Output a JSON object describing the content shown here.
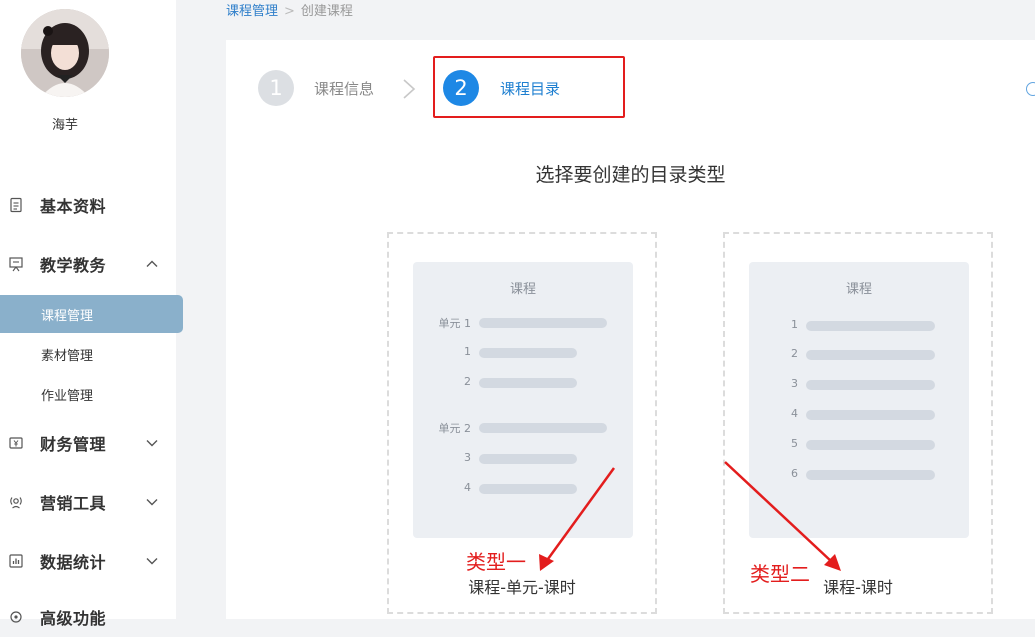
{
  "user": {
    "name": "海芋"
  },
  "sidebar": {
    "groups": [
      {
        "label": "基本资料",
        "icon": "document-icon"
      },
      {
        "label": "教学教务",
        "icon": "teaching-board-icon",
        "expanded": true,
        "items": [
          {
            "label": "课程管理",
            "active": true
          },
          {
            "label": "素材管理"
          },
          {
            "label": "作业管理"
          }
        ]
      },
      {
        "label": "财务管理",
        "icon": "finance-icon"
      },
      {
        "label": "营销工具",
        "icon": "broadcast-icon"
      },
      {
        "label": "数据统计",
        "icon": "chart-icon"
      },
      {
        "label": "高级功能",
        "icon": "advanced-icon"
      }
    ]
  },
  "breadcrumb": {
    "parent": "课程管理",
    "current": "创建课程",
    "separator": ">"
  },
  "steps": [
    {
      "number": "1",
      "label": "课程信息",
      "state": "done"
    },
    {
      "number": "2",
      "label": "课程目录",
      "state": "active"
    }
  ],
  "main": {
    "title": "选择要创建的目录类型"
  },
  "cards": [
    {
      "preview_title": "课程",
      "rows": [
        {
          "label": "单元 1",
          "bar": "long",
          "gap_before": false
        },
        {
          "label": "1",
          "bar": "short",
          "gap_before": false
        },
        {
          "label": "2",
          "bar": "short",
          "gap_before": false
        },
        {
          "label": "单元 2",
          "bar": "long",
          "gap_before": true
        },
        {
          "label": "3",
          "bar": "short",
          "gap_before": false
        },
        {
          "label": "4",
          "bar": "short",
          "gap_before": false
        }
      ],
      "caption": "课程-单元-课时",
      "annotation": "类型一"
    },
    {
      "preview_title": "课程",
      "rows": [
        {
          "label": "1",
          "bar": "long"
        },
        {
          "label": "2",
          "bar": "long"
        },
        {
          "label": "3",
          "bar": "long"
        },
        {
          "label": "4",
          "bar": "long"
        },
        {
          "label": "5",
          "bar": "long"
        },
        {
          "label": "6",
          "bar": "long"
        }
      ],
      "caption": "课程-课时",
      "annotation": "类型二"
    }
  ],
  "colors": {
    "accent": "#1e88e5",
    "annotation": "#e31d1d",
    "active_nav": "#8ab0cb"
  }
}
